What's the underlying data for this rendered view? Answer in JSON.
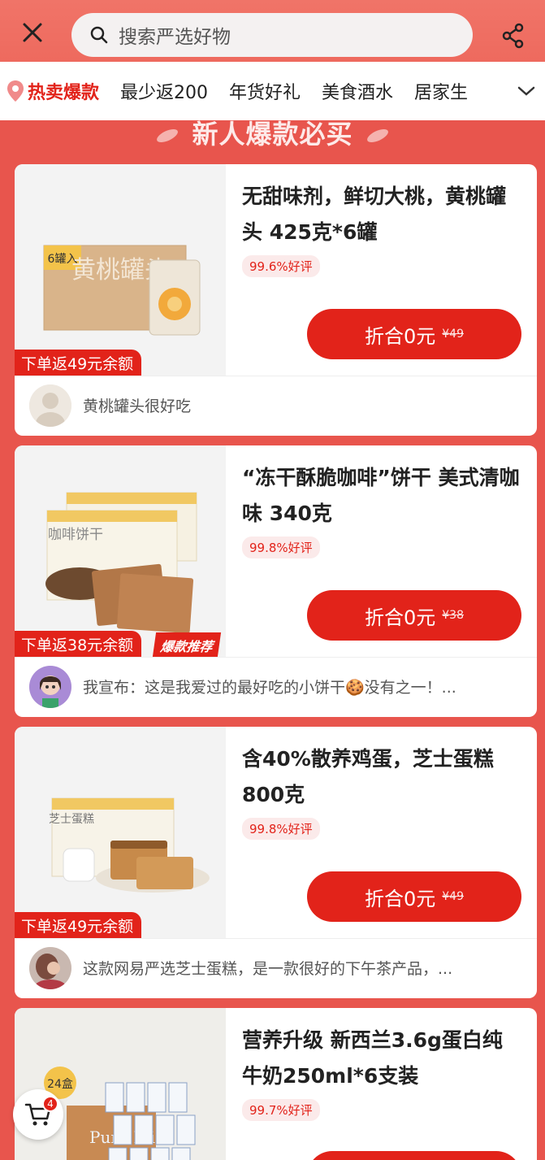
{
  "header": {
    "search_placeholder": "搜索严选好物",
    "close_icon": "close-icon",
    "share_icon": "share-icon"
  },
  "categories": {
    "items": [
      "热卖爆款",
      "最少返200",
      "年货好礼",
      "美食酒水",
      "居家生"
    ],
    "active_index": 0
  },
  "section_title": "新人爆款必买",
  "products": [
    {
      "title": "无甜味剂，鲜切大桃，黄桃罐头 425克*6罐",
      "rating": "99.6%好评",
      "price_label": "折合0元",
      "original_price": "¥49",
      "rebate": "下单返49元余额",
      "hot_tag": "",
      "review": "黄桃罐头很好吃",
      "image_text": "黄桃罐头",
      "image_badge": "6罐入"
    },
    {
      "title": "“冻干酥脆咖啡”饼干 美式清咖味 340克",
      "rating": "99.8%好评",
      "price_label": "折合0元",
      "original_price": "¥38",
      "rebate": "下单返38元余额",
      "hot_tag": "爆款推荐",
      "review": "我宣布：这是我爱过的最好吃的小饼干🍪没有之一！...",
      "image_text": "咖啡饼干",
      "image_badge": ""
    },
    {
      "title": "含40%散养鸡蛋，芝士蛋糕 800克",
      "rating": "99.8%好评",
      "price_label": "折合0元",
      "original_price": "¥49",
      "rebate": "下单返49元余额",
      "hot_tag": "",
      "review": "这款网易严选芝士蛋糕，是一款很好的下午茶产品，...",
      "image_text": "芝士蛋糕",
      "image_badge": ""
    },
    {
      "title": "营养升级 新西兰3.6g蛋白纯牛奶250ml*6支装",
      "rating": "99.7%好评",
      "price_label": "",
      "original_price": "",
      "rebate": "",
      "hot_tag": "",
      "review": "",
      "image_text": "Pure Milk",
      "image_badge": "24盒"
    }
  ],
  "cart": {
    "count": "4",
    "icon": "cart-icon"
  },
  "colors": {
    "accent": "#e2231a",
    "background": "#e8554d"
  }
}
